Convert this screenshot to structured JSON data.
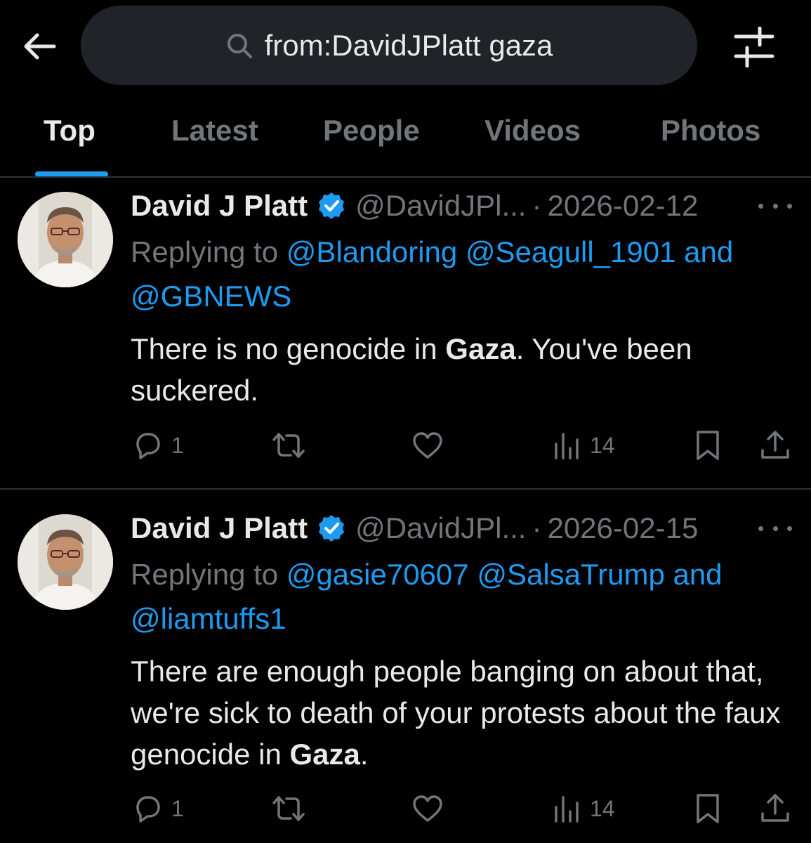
{
  "search": {
    "query": "from:DavidJPlatt gaza"
  },
  "tabs": [
    {
      "label": "Top"
    },
    {
      "label": "Latest"
    },
    {
      "label": "People"
    },
    {
      "label": "Videos"
    },
    {
      "label": "Photos"
    }
  ],
  "tweets": [
    {
      "name": "David J Platt",
      "handle": "@DavidJPl...",
      "sep": "·",
      "date": "2026-02-12",
      "replying_prefix": "Replying to",
      "mention1": "@Blandoring",
      "mention2": "@Seagull_1901",
      "and_word": "and",
      "mention3": "@GBNEWS",
      "text_pre": "There is no genocide in",
      "text_bold": "Gaza",
      "text_post": ". You've been suckered.",
      "replies": "1",
      "views": "14"
    },
    {
      "name": "David J Platt",
      "handle": "@DavidJPl...",
      "sep": "·",
      "date": "2026-02-15",
      "replying_prefix": "Replying to",
      "mention1": "@gasie70607",
      "mention2": "@SalsaTrump",
      "and_word": "and",
      "mention3": "@liamtuffs1",
      "text_pre": "There are enough people banging on about that, we're sick to death of your protests about the faux genocide in",
      "text_bold": "Gaza",
      "text_post": ".",
      "replies": "1",
      "views": "14"
    }
  ],
  "colors": {
    "background": "#000000",
    "accent": "#1d9bf0",
    "muted": "#71767b",
    "text": "#e7e9ea"
  },
  "icons": [
    "back-arrow-icon",
    "search-icon",
    "filter-sliders-icon",
    "verified-badge-icon",
    "more-icon",
    "reply-icon",
    "retweet-icon",
    "like-icon",
    "views-icon",
    "bookmark-icon",
    "share-icon"
  ]
}
